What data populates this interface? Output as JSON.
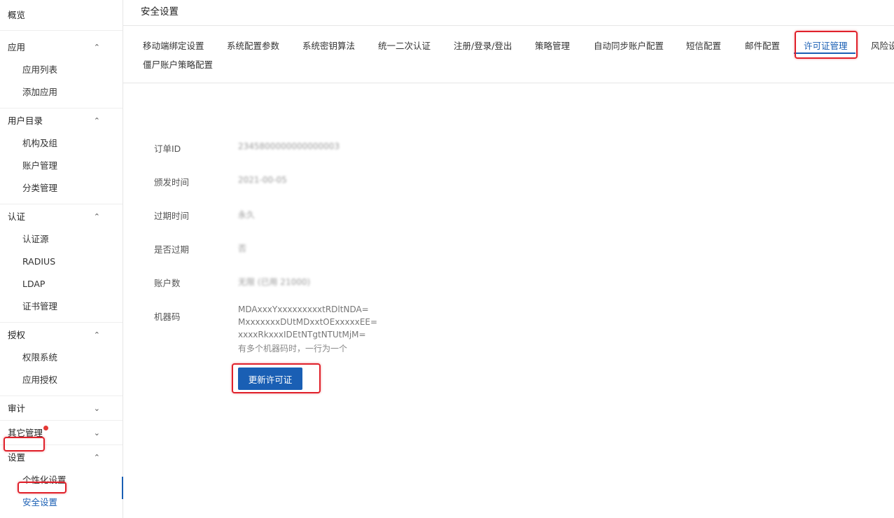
{
  "sidebar": {
    "overview": "概览",
    "groups": [
      {
        "label": "应用",
        "chevron": "up",
        "items": [
          "应用列表",
          "添加应用"
        ]
      },
      {
        "label": "用户目录",
        "chevron": "up",
        "items": [
          "机构及组",
          "账户管理",
          "分类管理"
        ]
      },
      {
        "label": "认证",
        "chevron": "up",
        "items": [
          "认证源",
          "RADIUS",
          "LDAP",
          "证书管理"
        ]
      },
      {
        "label": "授权",
        "chevron": "up",
        "items": [
          "权限系统",
          "应用授权"
        ]
      },
      {
        "label": "审计",
        "chevron": "down",
        "items": []
      },
      {
        "label": "其它管理",
        "chevron": "down",
        "items": []
      },
      {
        "label": "设置",
        "chevron": "up",
        "items": [
          "个性化设置",
          "安全设置"
        ]
      }
    ],
    "chevron_up": "⌃",
    "chevron_down": "⌄",
    "active_item": "安全设置"
  },
  "page": {
    "title": "安全设置"
  },
  "tabs": [
    "移动端绑定设置",
    "系统配置参数",
    "系统密钥算法",
    "统一二次认证",
    "注册/登录/登出",
    "策略管理",
    "自动同步账户配置",
    "短信配置",
    "邮件配置",
    "许可证管理",
    "风险设",
    "僵尸账户策略配置"
  ],
  "active_tab": "许可证管理",
  "license": {
    "order_id_label": "订单ID",
    "order_id_value": "2345800000000000003",
    "issue_time_label": "颁发时间",
    "issue_time_value": "2021-00-05",
    "expire_time_label": "过期时间",
    "expire_time_value": "永久",
    "expired_label": "是否过期",
    "expired_value": "否",
    "accounts_label": "账户数",
    "accounts_value": "无限 (已用 21000)",
    "machine_code_label": "机器码",
    "machine_codes": [
      "MDAxxxYxxxxxxxxxtRDltNDA=",
      "MxxxxxxxDUtMDxxtOExxxxxEE=",
      "xxxxRkxxxIDEtNTgtNTUtMjM="
    ],
    "machine_code_hint": "有多个机器码时，一行为一个",
    "update_button": "更新许可证"
  },
  "colors": {
    "accent": "#1a5fb4",
    "highlight_box": "#e0212b",
    "badge": "#e53935"
  }
}
